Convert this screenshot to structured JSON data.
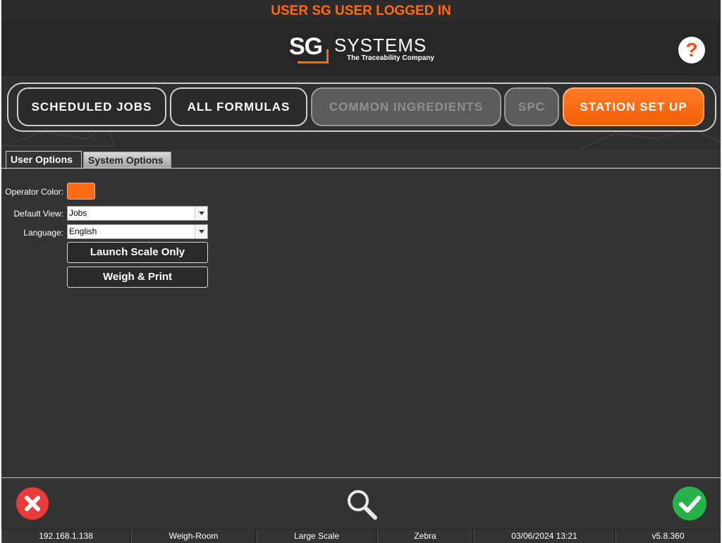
{
  "login_banner": "USER SG USER LOGGED IN",
  "brand": {
    "mark": "SG",
    "name": "SYSTEMS",
    "tagline": "The Traceability Company",
    "accent_color": "#ff6a13"
  },
  "help_label": "?",
  "nav": {
    "items": [
      {
        "label": "SCHEDULED JOBS",
        "state": "enabled"
      },
      {
        "label": "ALL FORMULAS",
        "state": "enabled"
      },
      {
        "label": "COMMON INGREDIENTS",
        "state": "disabled"
      },
      {
        "label": "SPC",
        "state": "disabled"
      },
      {
        "label": "STATION SET UP",
        "state": "active"
      }
    ]
  },
  "tabs": [
    {
      "label": "User Options",
      "selected": true
    },
    {
      "label": "System Options",
      "selected": false
    }
  ],
  "form": {
    "operator_color_label": "Operator Color:",
    "operator_color": "#ff6a13",
    "default_view_label": "Default View:",
    "default_view_value": "Jobs",
    "language_label": "Language:",
    "language_value": "English",
    "launch_scale_label": "Launch Scale Only",
    "weigh_print_label": "Weigh & Print"
  },
  "toolbar": {
    "cancel_icon": "close-icon",
    "search_icon": "search-icon",
    "confirm_icon": "check-icon"
  },
  "status_bar": [
    "192.168.1.138",
    "Weigh-Room",
    "Large Scale",
    "Zebra",
    "03/06/2024 13:21",
    "v5.8.360"
  ]
}
